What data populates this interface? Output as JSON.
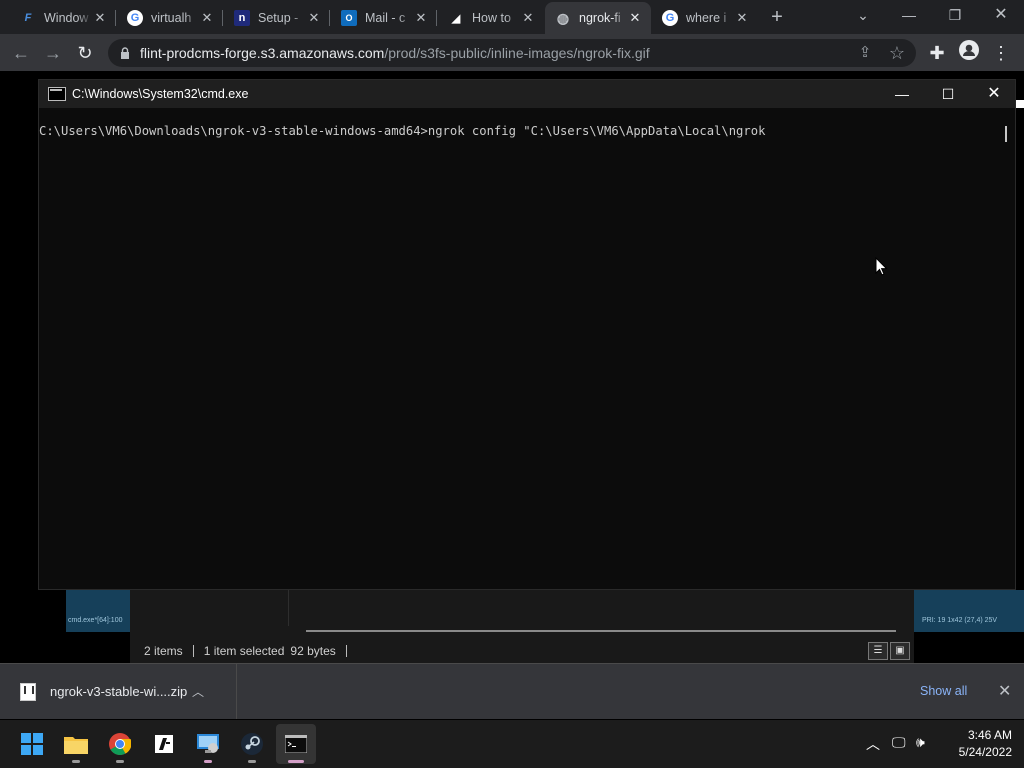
{
  "browser": {
    "tabs": [
      {
        "title": "Window",
        "icon": "windows-blue-icon"
      },
      {
        "title": "virtualh",
        "icon": "google-icon"
      },
      {
        "title": "Setup -",
        "icon": "ngrok-n-icon"
      },
      {
        "title": "Mail - c",
        "icon": "outlook-icon"
      },
      {
        "title": "How to",
        "icon": "site-icon"
      },
      {
        "title": "ngrok-fi",
        "icon": "globe-icon"
      },
      {
        "title": "where i",
        "icon": "google-icon"
      }
    ],
    "active_tab_index": 5,
    "url_host": "flint-prodcms-forge.s3.amazonaws.com",
    "url_path": "/prod/s3fs-public/inline-images/ngrok-fix.gif"
  },
  "cmd": {
    "title": "C:\\Windows\\System32\\cmd.exe",
    "line": "C:\\Users\\VM6\\Downloads\\ngrok-v3-stable-windows-amd64>ngrok config \"C:\\Users\\VM6\\AppData\\Local\\ngrok"
  },
  "background": {
    "left_status_fragment": "cmd.exe*[64]:100",
    "right_status_fragment": "PRI: 19 1x42   (27,4) 25V",
    "explorer_items": "2 items",
    "explorer_selected": "1 item selected",
    "explorer_size": "92 bytes"
  },
  "downloads": {
    "file_name": "ngrok-v3-stable-wi....zip",
    "show_all": "Show all"
  },
  "taskbar": {
    "time": "3:46 AM",
    "date": "5/24/2022"
  },
  "colors": {
    "tab_strip": "#202124",
    "toolbar": "#35363a",
    "console_bg": "#0c0c0c",
    "link": "#8ab4f8"
  }
}
